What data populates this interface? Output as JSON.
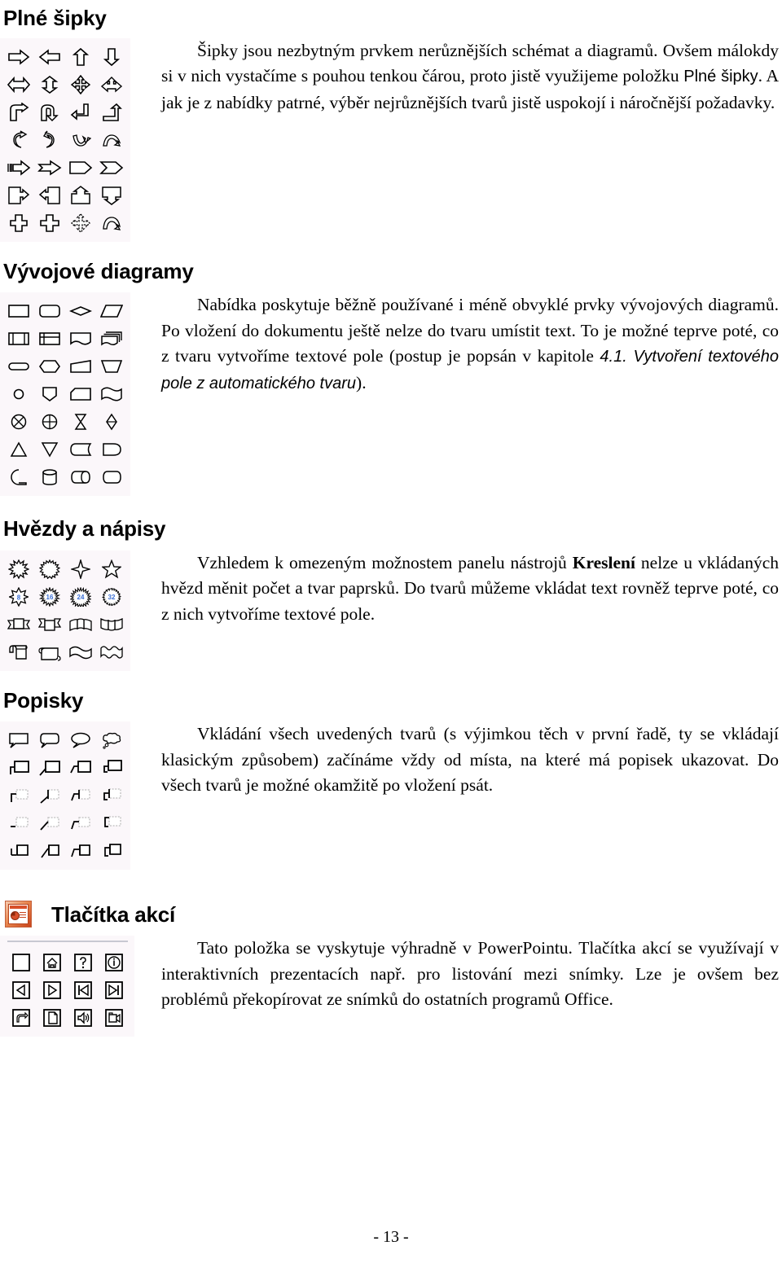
{
  "page": {
    "number_label": "- 13 -",
    "language": "cs"
  },
  "sections": [
    {
      "id": "plne-sipky",
      "heading": "Plné šipky",
      "palette_name": "block-arrows-palette",
      "palette_rows": 7,
      "palette_cols": 4,
      "paragraph": {
        "parts": [
          {
            "text": "Šipky jsou nezbytným prvkem nerůznějších schémat a diagramů. Ovšem málokdy si v nich vystačíme s pouhou tenkou čárou, proto jistě využijeme položku ",
            "style": "normal"
          },
          {
            "text": "Plné šipky",
            "style": "sans"
          },
          {
            "text": ". A jak je z nabídky patrné, výběr nejrůznějších tvarů jistě uspokojí i náročnější požadavky.",
            "style": "normal"
          }
        ]
      }
    },
    {
      "id": "vyvojove-diagramy",
      "heading": "Vývojové diagramy",
      "palette_name": "flowchart-palette",
      "palette_rows": 7,
      "palette_cols": 4,
      "paragraph": {
        "parts": [
          {
            "text": "Nabídka poskytuje běžně používané i méně obvyklé prvky vývojových diagramů. Po vložení do dokumentu ještě nelze do tvaru umístit text. To je možné teprve poté, co z tvaru vytvoříme textové pole (postup je popsán v kapitole ",
            "style": "normal"
          },
          {
            "text": "4.1. Vytvoření textového pole z automatického tvaru",
            "style": "sans-italic"
          },
          {
            "text": ").",
            "style": "normal"
          }
        ]
      }
    },
    {
      "id": "hvezdy-a-napisy",
      "heading": "Hvězdy a nápisy",
      "palette_name": "stars-and-banners-palette",
      "palette_rows": 4,
      "palette_cols": 4,
      "star_labels": [
        "8",
        "16",
        "24",
        "32"
      ],
      "star_label_color": "#3b6fd4",
      "paragraph": {
        "parts": [
          {
            "text": "Vzhledem k omezeným možnostem panelu nástrojů ",
            "style": "normal"
          },
          {
            "text": "Kreslení",
            "style": "bold"
          },
          {
            "text": " nelze u vkládaných hvězd měnit počet a tvar paprsků. Do tvarů můžeme vkládat text rovněž teprve poté, co z nich vytvoříme textové pole.",
            "style": "normal"
          }
        ]
      }
    },
    {
      "id": "popisky",
      "heading": "Popisky",
      "palette_name": "callouts-palette",
      "palette_rows": 5,
      "palette_cols": 4,
      "paragraph": {
        "parts": [
          {
            "text": "Vkládání všech uvedených tvarů (s výjimkou těch v první řadě, ty se vkládají klasickým způsobem) začínáme vždy od místa, na které má popisek ukazovat. Do všech tvarů je možné okamžitě po vložení psát.",
            "style": "normal"
          }
        ]
      }
    },
    {
      "id": "tlacitka-akci",
      "heading": "Tlačítka akcí",
      "heading_icon": "powerpoint-icon",
      "palette_name": "action-buttons-palette",
      "palette_rows": 3,
      "palette_cols": 4,
      "paragraph": {
        "parts": [
          {
            "text": "Tato položka se vyskytuje výhradně v PowerPointu. Tlačítka akcí se využívají v interaktivních prezentacích např. pro listování mezi snímky. Lze je ovšem bez problémů překopírovat ze snímků do ostatních programů Office.",
            "style": "normal"
          }
        ]
      }
    }
  ],
  "colors": {
    "palette_background": "#fbf7fa",
    "ink": "#000000",
    "star_number": "#3b6fd4",
    "ppt_orange": "#d8502a",
    "separator": "#c8c8d2"
  }
}
